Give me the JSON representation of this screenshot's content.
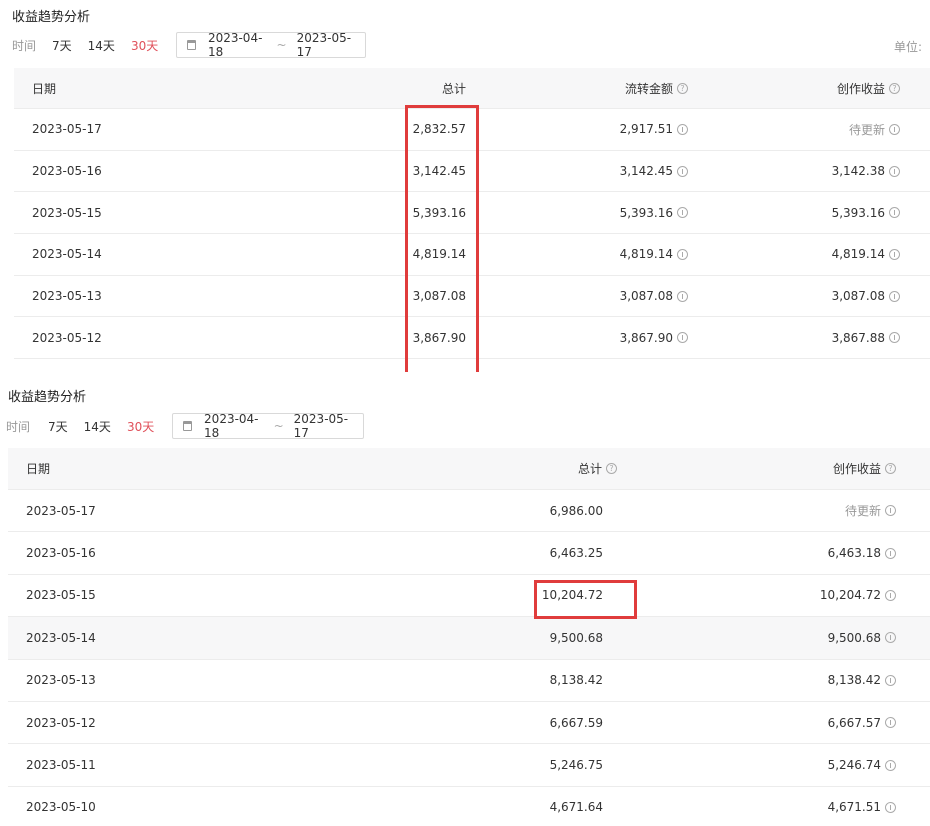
{
  "panel1": {
    "title": "收益趋势分析",
    "filter_label": "时间",
    "options": [
      "7天",
      "14天",
      "30天"
    ],
    "date_start": "2023-04-18",
    "date_sep": "~",
    "date_end": "2023-05-17",
    "unit_label": "单位: ",
    "headers": [
      "日期",
      "总计",
      "流转金额",
      "创作收益"
    ],
    "rows": [
      {
        "date": "2023-05-17",
        "total": "2,832.57",
        "flow": "2,917.51",
        "creation": "待更新"
      },
      {
        "date": "2023-05-16",
        "total": "3,142.45",
        "flow": "3,142.45",
        "creation": "3,142.38"
      },
      {
        "date": "2023-05-15",
        "total": "5,393.16",
        "flow": "5,393.16",
        "creation": "5,393.16"
      },
      {
        "date": "2023-05-14",
        "total": "4,819.14",
        "flow": "4,819.14",
        "creation": "4,819.14"
      },
      {
        "date": "2023-05-13",
        "total": "3,087.08",
        "flow": "3,087.08",
        "creation": "3,087.08"
      },
      {
        "date": "2023-05-12",
        "total": "3,867.90",
        "flow": "3,867.90",
        "creation": "3,867.88"
      }
    ]
  },
  "panel2": {
    "title": "收益趋势分析",
    "filter_label": "时间",
    "options": [
      "7天",
      "14天",
      "30天"
    ],
    "date_start": "2023-04-18",
    "date_sep": "~",
    "date_end": "2023-05-17",
    "headers": [
      "日期",
      "总计",
      "创作收益"
    ],
    "rows": [
      {
        "date": "2023-05-17",
        "total": "6,986.00",
        "creation": "待更新"
      },
      {
        "date": "2023-05-16",
        "total": "6,463.25",
        "creation": "6,463.18"
      },
      {
        "date": "2023-05-15",
        "total": "10,204.72",
        "creation": "10,204.72"
      },
      {
        "date": "2023-05-14",
        "total": "9,500.68",
        "creation": "9,500.68"
      },
      {
        "date": "2023-05-13",
        "total": "8,138.42",
        "creation": "8,138.42"
      },
      {
        "date": "2023-05-12",
        "total": "6,667.59",
        "creation": "6,667.57"
      },
      {
        "date": "2023-05-11",
        "total": "5,246.75",
        "creation": "5,246.74"
      },
      {
        "date": "2023-05-10",
        "total": "4,671.64",
        "creation": "4,671.51"
      }
    ]
  },
  "colors": {
    "active_filter": "#e0505a",
    "highlight_box": "#e03c3c"
  }
}
